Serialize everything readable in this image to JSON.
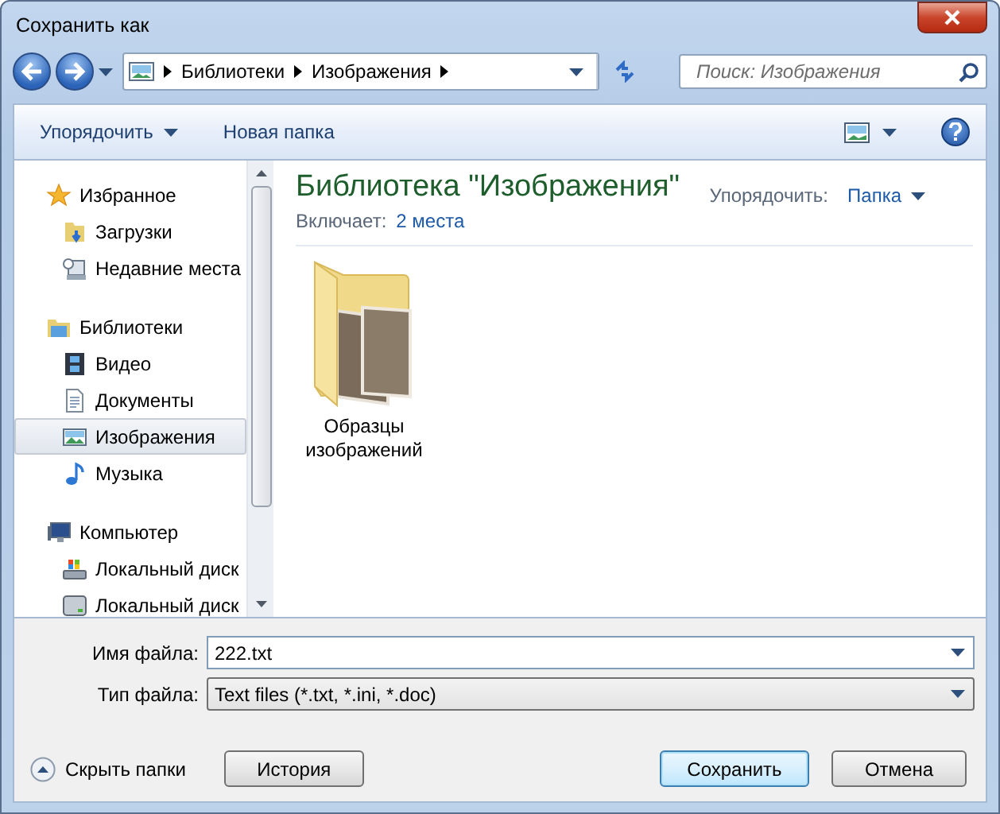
{
  "window": {
    "title": "Сохранить как"
  },
  "address": {
    "crumbs": [
      "Библиотеки",
      "Изображения"
    ]
  },
  "search": {
    "placeholder": "Поиск: Изображения"
  },
  "toolbar": {
    "organize": "Упорядочить",
    "new_folder": "Новая папка"
  },
  "nav": [
    {
      "label": "Избранное",
      "kind": "star",
      "selected": false,
      "children": [
        {
          "label": "Загрузки",
          "kind": "download",
          "selected": false
        },
        {
          "label": "Недавние места",
          "kind": "recent",
          "selected": false
        }
      ]
    },
    {
      "label": "Библиотеки",
      "kind": "library",
      "selected": false,
      "children": [
        {
          "label": "Видео",
          "kind": "video",
          "selected": false
        },
        {
          "label": "Документы",
          "kind": "documents",
          "selected": false
        },
        {
          "label": "Изображения",
          "kind": "pictures",
          "selected": true
        },
        {
          "label": "Музыка",
          "kind": "music",
          "selected": false
        }
      ]
    },
    {
      "label": "Компьютер",
      "kind": "computer",
      "selected": false,
      "children": [
        {
          "label": "Локальный диск",
          "kind": "system-disk",
          "selected": false
        },
        {
          "label": "Локальный диск",
          "kind": "disk",
          "selected": false
        }
      ]
    }
  ],
  "library": {
    "title": "Библиотека \"Изображения\"",
    "includes_label": "Включает:",
    "includes_link": "2 места",
    "arrange_label": "Упорядочить:",
    "arrange_value": "Папка"
  },
  "items": [
    {
      "label": "Образцы изображений"
    }
  ],
  "filename": {
    "label": "Имя файла:",
    "value": "222.txt"
  },
  "filetype": {
    "label": "Тип файла:",
    "value": "Text files (*.txt, *.ini, *.doc)"
  },
  "hide_folders": "Скрыть папки",
  "history_button": "История",
  "buttons": [
    {
      "label": "Сохранить",
      "default": true
    },
    {
      "label": "Отмена",
      "default": false
    }
  ]
}
